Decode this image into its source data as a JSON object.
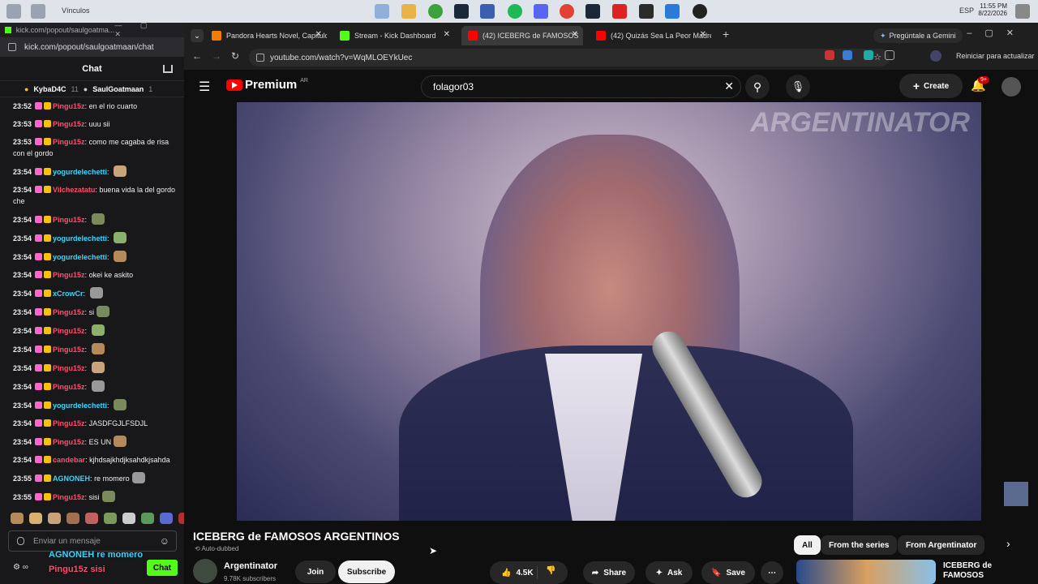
{
  "taskbar": {
    "folder_label": "Vínculos",
    "time": "11:55 PM",
    "date": "8/22/2026",
    "lang": "ESP"
  },
  "kick": {
    "window_title": "kick.com/popout/saulgoatma...",
    "address": "kick.com/popout/saulgoatmaan/chat",
    "header": "Chat",
    "pinned": [
      {
        "name": "KybaD4C",
        "count": "11"
      },
      {
        "name": "SaulGoatmaan",
        "count": "1"
      }
    ],
    "messages": [
      {
        "time": "23:52",
        "user": "Pingu15z",
        "cls": "u1",
        "text": "en el rio cuarto"
      },
      {
        "time": "23:53",
        "user": "Pingu15z",
        "cls": "u1",
        "text": "uuu sii"
      },
      {
        "time": "23:53",
        "user": "Pingu15z",
        "cls": "u1",
        "text": "como me cagaba de risa con el gordo"
      },
      {
        "time": "23:54",
        "user": "yogurdelechetti",
        "cls": "u2",
        "text": ""
      },
      {
        "time": "23:54",
        "user": "Vilchezatatu",
        "cls": "u1",
        "text": "buena vida la del gordo che"
      },
      {
        "time": "23:54",
        "user": "Pingu15z",
        "cls": "u1",
        "text": ""
      },
      {
        "time": "23:54",
        "user": "yogurdelechetti",
        "cls": "u2",
        "text": ""
      },
      {
        "time": "23:54",
        "user": "yogurdelechetti",
        "cls": "u2",
        "text": ""
      },
      {
        "time": "23:54",
        "user": "Pingu15z",
        "cls": "u1",
        "text": "okei ke askito"
      },
      {
        "time": "23:54",
        "user": "xCrowCr",
        "cls": "u2",
        "text": ""
      },
      {
        "time": "23:54",
        "user": "Pingu15z",
        "cls": "u1",
        "text": "si"
      },
      {
        "time": "23:54",
        "user": "Pingu15z",
        "cls": "u1",
        "text": ""
      },
      {
        "time": "23:54",
        "user": "Pingu15z",
        "cls": "u1",
        "text": ""
      },
      {
        "time": "23:54",
        "user": "Pingu15z",
        "cls": "u1",
        "text": ""
      },
      {
        "time": "23:54",
        "user": "Pingu15z",
        "cls": "u1",
        "text": ""
      },
      {
        "time": "23:54",
        "user": "yogurdelechetti",
        "cls": "u2",
        "text": ""
      },
      {
        "time": "23:54",
        "user": "Pingu15z",
        "cls": "u1",
        "text": "JASDFGJLFSDJL"
      },
      {
        "time": "23:54",
        "user": "Pingu15z",
        "cls": "u1",
        "text": "ES UN"
      },
      {
        "time": "23:54",
        "user": "candebar",
        "cls": "u1",
        "text": "kjhdsajkhdjksahdkjsahda"
      },
      {
        "time": "23:55",
        "user": "AGNONEH",
        "cls": "u2",
        "text": "re momero"
      },
      {
        "time": "23:55",
        "user": "Pingu15z",
        "cls": "u1",
        "text": "sisi"
      }
    ],
    "input_placeholder": "Enviar un mensaje",
    "chat_button": "Chat",
    "overlay_lines": [
      "AGNONEH re momero",
      "Pingu15z sisi"
    ]
  },
  "browser": {
    "tabs": [
      {
        "title": "Pandora Hearts Novel, Capitulo",
        "color": "#f57c00"
      },
      {
        "title": "Stream - Kick Dashboard",
        "color": "#53fc18"
      },
      {
        "title": "(42) ICEBERG de FAMOSOS",
        "color": "#ff0000"
      },
      {
        "title": "(42) Quizás Sea La Peor Madre",
        "color": "#ff0000"
      }
    ],
    "url": "youtube.com/watch?v=WqMLOEYkUec",
    "gemini": "Pregúntale a Gemini",
    "update": "Reiniciar para actualizar"
  },
  "yt": {
    "logo": "Premium",
    "region": "AR",
    "search": "folagor03",
    "create": "Create",
    "notif": "9+",
    "watermark": "ARGENTINATOR",
    "title": "ICEBERG de FAMOSOS ARGENTINOS",
    "auto_dubbed": "Auto-dubbed",
    "channel": "Argentinator",
    "subs": "9.78K subscribers",
    "join": "Join",
    "subscribe": "Subscribe",
    "likes": "4.5K",
    "share": "Share",
    "ask": "Ask",
    "save": "Save",
    "chips": [
      "All",
      "From the series",
      "From Argentinator"
    ],
    "related_title": "ICEBERG de FAMOSOS"
  }
}
